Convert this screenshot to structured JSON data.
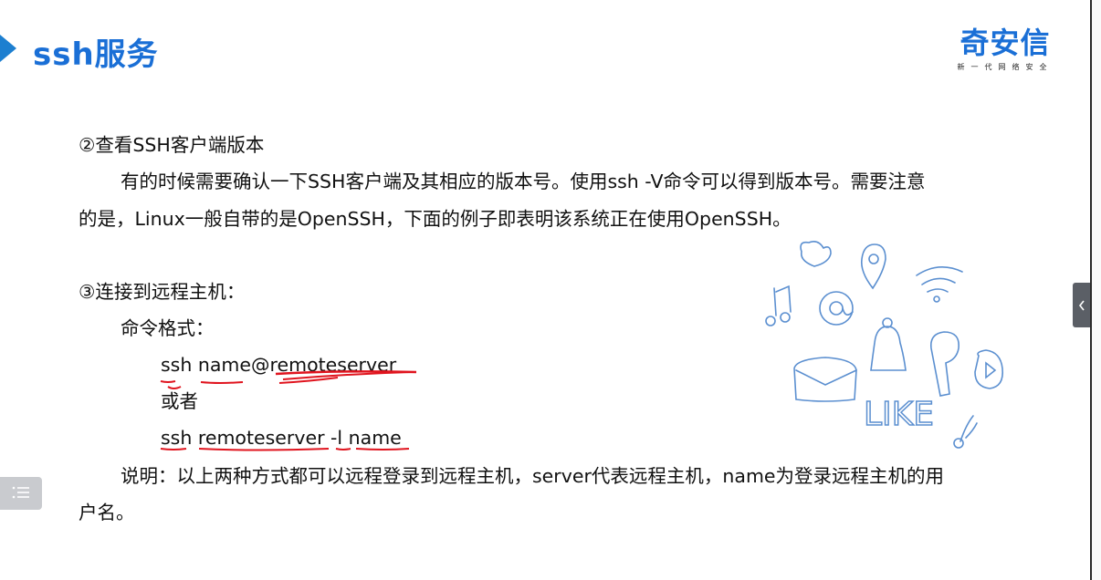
{
  "header": {
    "title": "ssh服务",
    "logo_name": "奇安信",
    "logo_tagline": "新一代网络安全"
  },
  "content": {
    "section2_heading": "②查看SSH客户端版本",
    "section2_para_line1": "有的时候需要确认一下SSH客户端及其相应的版本号。使用ssh -V命令可以得到版本号。需要注意",
    "section2_para_line2": "的是，Linux一般自带的是OpenSSH，下面的例子即表明该系统正在使用OpenSSH。",
    "section3_heading": "③连接到远程主机：",
    "command_format_label": "命令格式：",
    "command1": "ssh name@remoteserver",
    "or_label": "或者",
    "command2": "ssh remoteserver -l name",
    "explanation_line1": "说明：以上两种方式都可以远程登录到远程主机，server代表远程主机，name为登录远程主机的用",
    "explanation_line2": "户名。"
  },
  "doodle": {
    "like_text": "LIKE"
  },
  "colors": {
    "title_blue": "#1a6fd6",
    "annotation_red": "#e0141e",
    "doodle_blue": "#5b8fd0"
  },
  "icons": {
    "collapse": "chevron-left-icon",
    "menu": "list-icon"
  }
}
